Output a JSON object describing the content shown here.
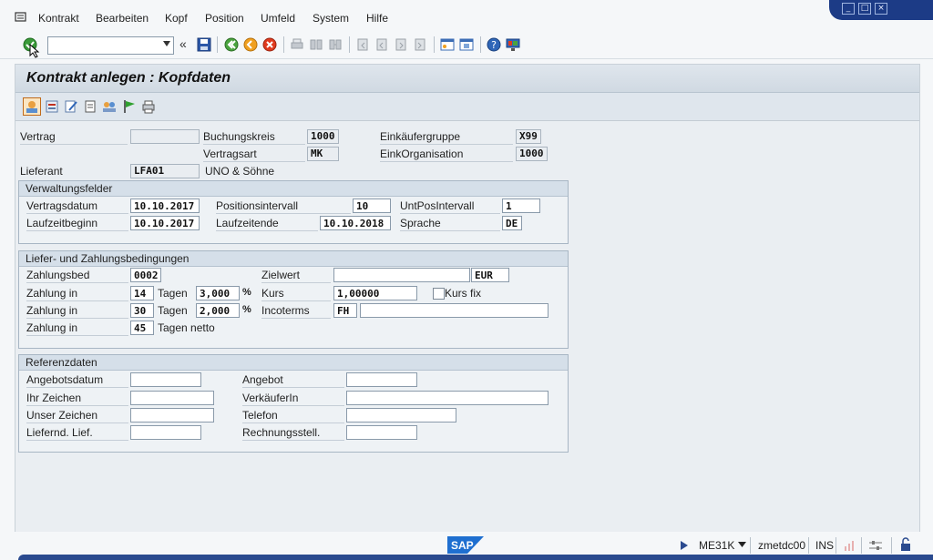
{
  "menu": {
    "items": [
      "Kontrakt",
      "Bearbeiten",
      "Kopf",
      "Position",
      "Umfeld",
      "System",
      "Hilfe"
    ]
  },
  "toolbar": {
    "command_value": ""
  },
  "title": "Kontrakt anlegen : Kopfdaten",
  "header": {
    "vertrag_label": "Vertrag",
    "vertrag_value": "",
    "buchungskreis_label": "Buchungskreis",
    "buchungskreis_value": "1000",
    "vertragsart_label": "Vertragsart",
    "vertragsart_value": "MK",
    "einkaeufergruppe_label": "Einkäufergruppe",
    "einkaeufergruppe_value": "X99",
    "einkorganisation_label": "EinkOrganisation",
    "einkorganisation_value": "1000",
    "lieferant_label": "Lieferant",
    "lieferant_value": "LFA01",
    "lieferant_name": "UNO & Söhne"
  },
  "verwaltung": {
    "title": "Verwaltungsfelder",
    "vertragsdatum_label": "Vertragsdatum",
    "vertragsdatum_value": "10.10.2017",
    "positionsintervall_label": "Positionsintervall",
    "positionsintervall_value": "10",
    "untposintervall_label": "UntPosIntervall",
    "untposintervall_value": "1",
    "laufzeitbeginn_label": "Laufzeitbeginn",
    "laufzeitbeginn_value": "10.10.2017",
    "laufzeitende_label": "Laufzeitende",
    "laufzeitende_value": "10.10.2018",
    "sprache_label": "Sprache",
    "sprache_value": "DE"
  },
  "zahlung": {
    "title": "Liefer- und Zahlungsbedingungen",
    "zahlungsbed_label": "Zahlungsbed",
    "zahlungsbed_value": "0002",
    "zielwert_label": "Zielwert",
    "zielwert_value": "",
    "waehrung_value": "EUR",
    "rows": [
      {
        "label": "Zahlung in",
        "days": "14",
        "unit": "Tagen",
        "pct": "3,000",
        "pct_sign": "%"
      },
      {
        "label": "Zahlung in",
        "days": "30",
        "unit": "Tagen",
        "pct": "2,000",
        "pct_sign": "%"
      },
      {
        "label": "Zahlung in",
        "days": "45",
        "unit": "Tagen netto"
      }
    ],
    "kurs_label": "Kurs",
    "kurs_value": "1,00000",
    "kursfix_label": "Kurs fix",
    "incoterms_label": "Incoterms",
    "incoterms_value": "FH",
    "incoterms_text": ""
  },
  "referenz": {
    "title": "Referenzdaten",
    "angebotsdatum_label": "Angebotsdatum",
    "ihrzeichen_label": "Ihr Zeichen",
    "unserzeichen_label": "Unser Zeichen",
    "lieferndlief_label": "Liefernd. Lief.",
    "angebot_label": "Angebot",
    "verkaeufer_label": "VerkäuferIn",
    "telefon_label": "Telefon",
    "rechnungsstell_label": "Rechnungsstell."
  },
  "status": {
    "tcode": "ME31K",
    "server": "zmetdc00",
    "mode": "INS",
    "logo_text": "SAP"
  },
  "colors": {
    "accent_blue": "#1c3b86",
    "group_header": "#d5dfe9",
    "input_border": "#8a9aaa"
  }
}
